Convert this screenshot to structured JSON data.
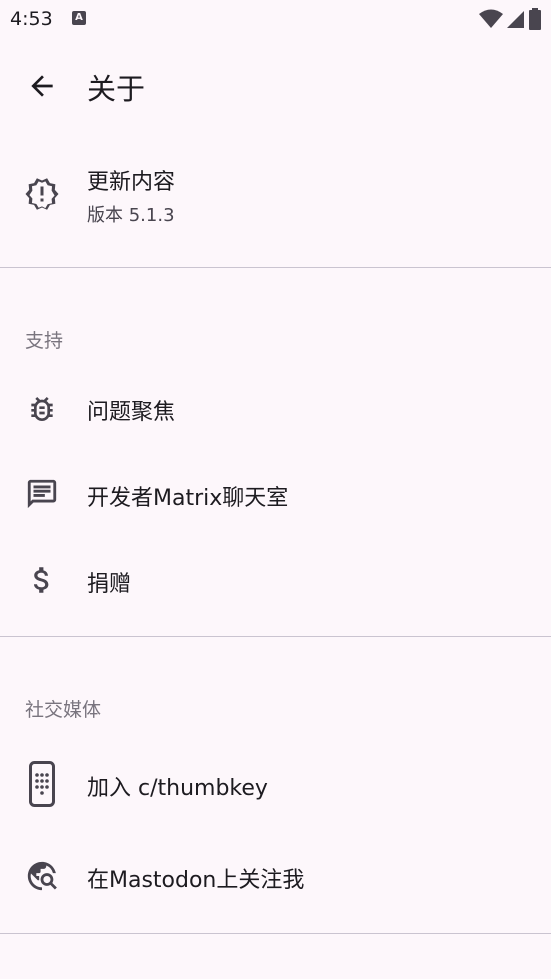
{
  "status_bar": {
    "time": "4:53",
    "notification_icon": "keyboard-icon",
    "wifi_icon": "wifi-icon",
    "signal_icon": "signal-icon",
    "battery_icon": "battery-icon"
  },
  "app_bar": {
    "back_icon": "arrow-back-icon",
    "title": "关于"
  },
  "whats_new": {
    "icon": "new-releases-icon",
    "label": "更新内容",
    "version": "版本 5.1.3"
  },
  "support": {
    "header": "支持",
    "items": [
      {
        "icon": "bug-icon",
        "label": "问题聚焦"
      },
      {
        "icon": "chat-icon",
        "label": "开发者Matrix聊天室"
      },
      {
        "icon": "dollar-icon",
        "label": "捐赠"
      }
    ]
  },
  "social": {
    "header": "社交媒体",
    "items": [
      {
        "icon": "phone-keypad-icon",
        "label": "加入 c/thumbkey"
      },
      {
        "icon": "travel-explore-icon",
        "label": "在Mastodon上关注我"
      }
    ]
  },
  "colors": {
    "background": "#fdf7fb",
    "text": "#1d1b20",
    "secondary_text": "#49454f",
    "section_header": "#79747e",
    "divider": "#cac4d0"
  }
}
